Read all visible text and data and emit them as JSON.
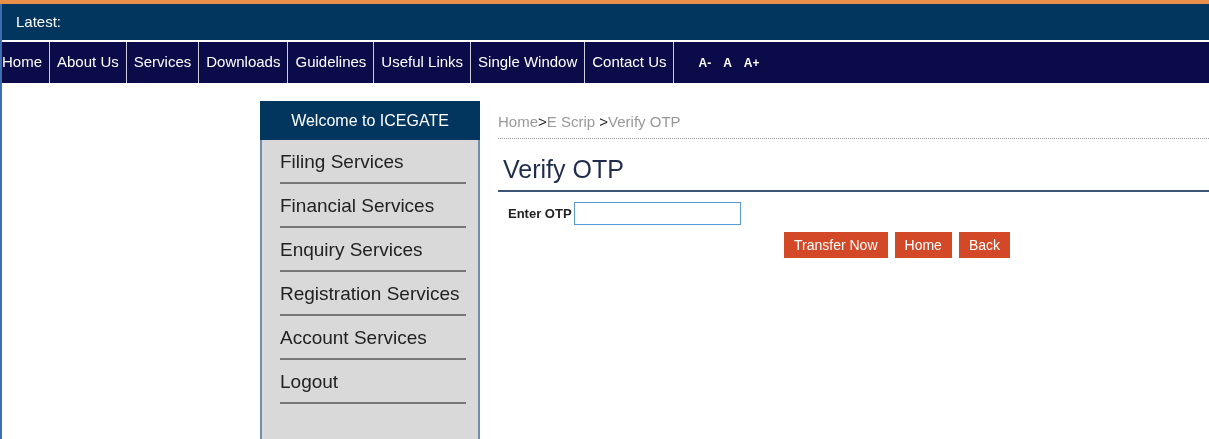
{
  "ticker": {
    "label": "Latest:"
  },
  "nav": {
    "items": [
      "Home",
      "About Us",
      "Services",
      "Downloads",
      "Guidelines",
      "Useful Links",
      "Single Window",
      "Contact Us"
    ],
    "font_sizes": [
      "A-",
      "A",
      "A+"
    ]
  },
  "sidebar": {
    "title": "Welcome to ICEGATE",
    "items": [
      "Filing Services",
      "Financial Services",
      "Enquiry Services",
      "Registration Services",
      "Account Services",
      "Logout"
    ]
  },
  "breadcrumb": [
    {
      "kind": "link",
      "text": "Home"
    },
    {
      "kind": "separator",
      "text": ">"
    },
    {
      "kind": "link",
      "text": "E Scrip "
    },
    {
      "kind": "separator",
      "text": ">"
    },
    {
      "kind": "link",
      "text": "Verify OTP"
    }
  ],
  "page_title": "Verify OTP",
  "form": {
    "label": "Enter OTP",
    "buttons": [
      "Transfer Now",
      "Home",
      "Back"
    ]
  }
}
